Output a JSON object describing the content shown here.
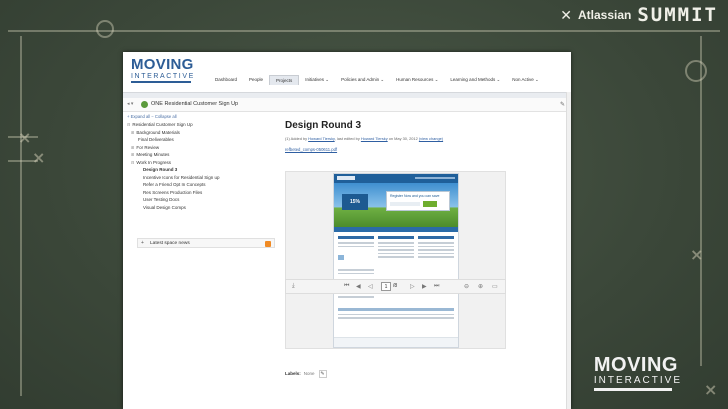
{
  "event": {
    "vendor": "Atlassian",
    "name": "SUMMIT"
  },
  "corner_logo": {
    "word1": "MOVING",
    "word2": "INTERACTIVE"
  },
  "app": {
    "logo_word1": "MOVING",
    "logo_word2": "INTERACTIVE",
    "tabs": [
      {
        "label": "Dashboard"
      },
      {
        "label": "People"
      },
      {
        "label": "Projects"
      },
      {
        "label": "Initiatives ⌄"
      },
      {
        "label": "Policies and Admin ⌄"
      },
      {
        "label": "Human Resources ⌄"
      },
      {
        "label": "Learning and Methods ⌄"
      },
      {
        "label": "Non Active ⌄"
      }
    ],
    "active_tab_index": 2,
    "space_title": "ONE Residential Customer Sign Up"
  },
  "tree": {
    "expand_collapse": "+ Expand all  − Collapse all",
    "nodes": [
      {
        "sign": "⊟",
        "label": "Residential Customer Sign Up"
      },
      {
        "sign": "⊞",
        "label": "Background Materials"
      },
      {
        "sign": "",
        "label": "Final Deliverables"
      },
      {
        "sign": "⊞",
        "label": "For Review"
      },
      {
        "sign": "⊞",
        "label": "Meeting Minutes"
      },
      {
        "sign": "⊟",
        "label": "Work In Progress"
      },
      {
        "sign": "",
        "label": "Design Round 3"
      },
      {
        "sign": "",
        "label": "Incentive Icons for Residential Sign up"
      },
      {
        "sign": "",
        "label": "Refer a Friend Opt In Concepts"
      },
      {
        "sign": "",
        "label": "Res Screens Production Files"
      },
      {
        "sign": "",
        "label": "User Testing Docs"
      },
      {
        "sign": "",
        "label": "Visual Design Comps"
      }
    ],
    "current_index": 6,
    "space_news": "Latest space news"
  },
  "page": {
    "title": "Design Round 3",
    "meta_prefix": "(1) Added by",
    "author": "Howard Tiersky",
    "meta_middle": ", last edited by",
    "editor": "Howard Tiersky",
    "meta_date": " on May 30, 2012",
    "view_change": "(view change)",
    "attachment": "refbeted_comps-050611.pdf",
    "labels_title": "Labels:",
    "labels_value": "None"
  },
  "viewer": {
    "current_page": "1",
    "total_pages": "/8",
    "mock_badge": "15%",
    "mock_panel_title": "Register Now and you can save"
  }
}
